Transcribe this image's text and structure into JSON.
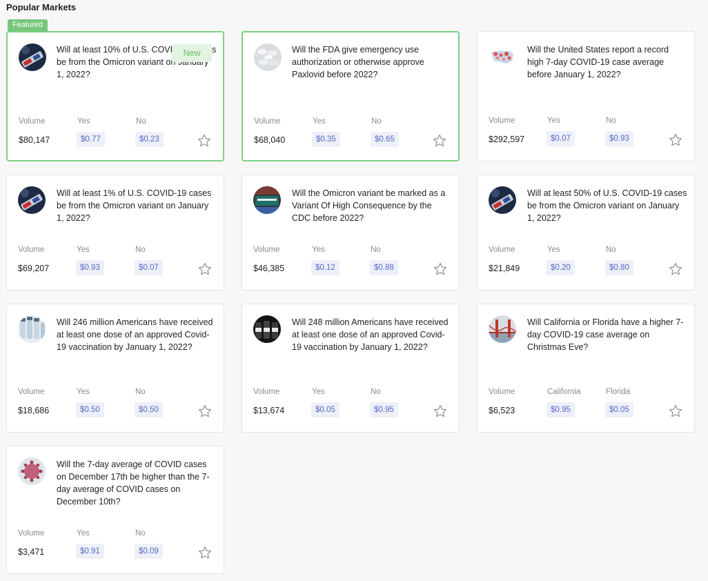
{
  "section": {
    "title": "Popular Markets"
  },
  "featured_label": "Featured",
  "new_label": "New",
  "volume_label": "Volume",
  "markets": [
    {
      "question": "Will at least 10% of U.S. COVID-19 cases be from the Omicron variant on January 1, 2022?",
      "volume": "$80,147",
      "outcome_a": {
        "label": "Yes",
        "price": "$0.77"
      },
      "outcome_b": {
        "label": "No",
        "price": "$0.23"
      },
      "thumbnail": "vaccine-vial-image",
      "featured": true,
      "is_new": true
    },
    {
      "question": "Will the FDA give emergency use authorization or otherwise approve Paxlovid before 2022?",
      "volume": "$68,040",
      "outcome_a": {
        "label": "Yes",
        "price": "$0.35"
      },
      "outcome_b": {
        "label": "No",
        "price": "$0.65"
      },
      "thumbnail": "pills-image",
      "featured": true,
      "is_new": false
    },
    {
      "question": "Will the United States report a record high 7-day COVID-19 case average before January 1, 2022?",
      "volume": "$292,597",
      "outcome_a": {
        "label": "Yes",
        "price": "$0.07"
      },
      "outcome_b": {
        "label": "No",
        "price": "$0.93"
      },
      "thumbnail": "us-map-image",
      "featured": false,
      "is_new": false
    },
    {
      "question": "Will at least 1% of U.S. COVID-19 cases be from the Omicron variant on January 1, 2022?",
      "volume": "$69,207",
      "outcome_a": {
        "label": "Yes",
        "price": "$0.93"
      },
      "outcome_b": {
        "label": "No",
        "price": "$0.07"
      },
      "thumbnail": "vaccine-vial-image",
      "featured": false,
      "is_new": false
    },
    {
      "question": "Will the Omicron variant be marked as a Variant Of High Consequence by the CDC before 2022?",
      "volume": "$46,385",
      "outcome_a": {
        "label": "Yes",
        "price": "$0.12"
      },
      "outcome_b": {
        "label": "No",
        "price": "$0.88"
      },
      "thumbnail": "omicron-sign-image",
      "featured": false,
      "is_new": false
    },
    {
      "question": "Will at least 50% of U.S. COVID-19 cases be from the Omicron variant on January 1, 2022?",
      "volume": "$21,849",
      "outcome_a": {
        "label": "Yes",
        "price": "$0.20"
      },
      "outcome_b": {
        "label": "No",
        "price": "$0.80"
      },
      "thumbnail": "vaccine-vial-image",
      "featured": false,
      "is_new": false
    },
    {
      "question": "Will 246 million Americans have received at least one dose of an approved Covid-19 vaccination by January 1, 2022?",
      "volume": "$18,686",
      "outcome_a": {
        "label": "Yes",
        "price": "$0.50"
      },
      "outcome_b": {
        "label": "No",
        "price": "$0.50"
      },
      "thumbnail": "vaccine-vials-image",
      "featured": false,
      "is_new": false
    },
    {
      "question": "Will 248 million Americans have received at least one dose of an approved Covid-19 vaccination by January 1, 2022?",
      "volume": "$13,674",
      "outcome_a": {
        "label": "Yes",
        "price": "$0.05"
      },
      "outcome_b": {
        "label": "No",
        "price": "$0.95"
      },
      "thumbnail": "vaccine-vials-dark-image",
      "featured": false,
      "is_new": false
    },
    {
      "question": "Will California or Florida have a higher 7-day COVID-19 case average on Christmas Eve?",
      "volume": "$6,523",
      "outcome_a": {
        "label": "California",
        "price": "$0.95"
      },
      "outcome_b": {
        "label": "Florida",
        "price": "$0.05"
      },
      "thumbnail": "golden-gate-bridge-image",
      "featured": false,
      "is_new": false
    },
    {
      "question": "Will the 7-day average of COVID cases on December 17th be higher than the 7-day average of COVID cases on December 10th?",
      "volume": "$3,471",
      "outcome_a": {
        "label": "Yes",
        "price": "$0.91"
      },
      "outcome_b": {
        "label": "No",
        "price": "$0.09"
      },
      "thumbnail": "coronavirus-image",
      "featured": false,
      "is_new": false
    }
  ],
  "icons": {
    "favorite": "star-outline-icon"
  },
  "colors": {
    "featured_border": "#7fcf7f",
    "featured_tag": "#77c77a",
    "price_text": "#5566c8",
    "price_bg": "#eef0f9"
  }
}
